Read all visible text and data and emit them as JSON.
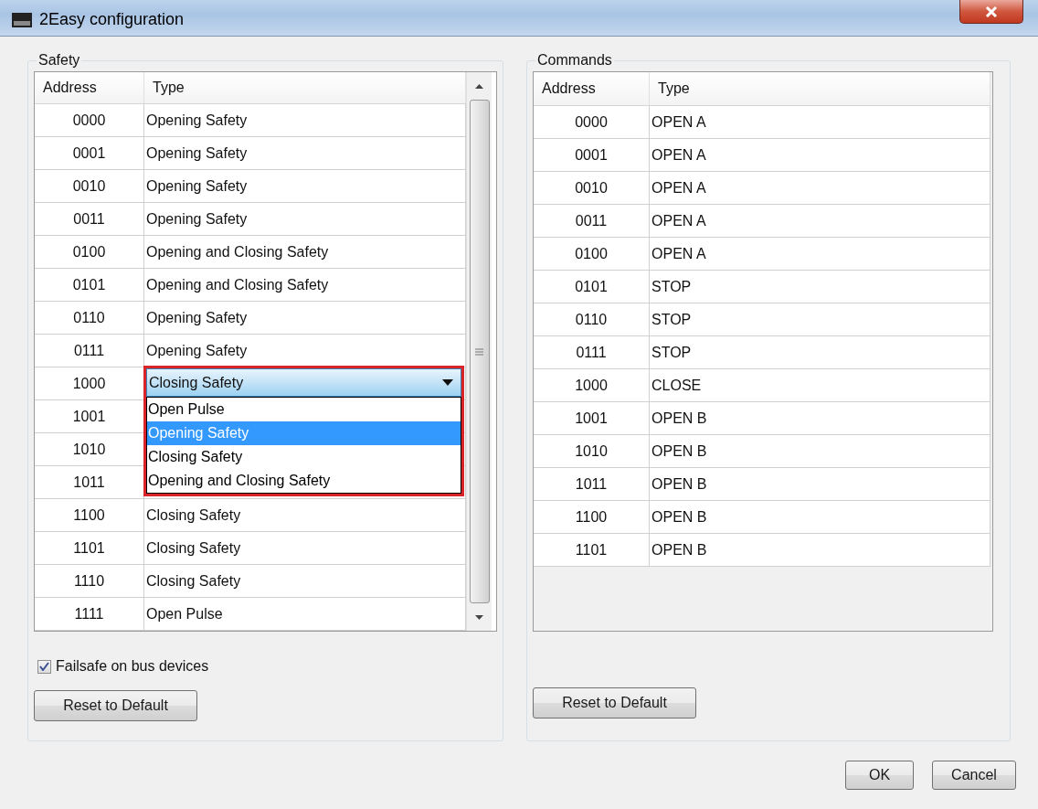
{
  "window": {
    "title": "2Easy configuration"
  },
  "safety": {
    "title": "Safety",
    "columns": [
      "Address",
      "Type"
    ],
    "rows": [
      {
        "address": "0000",
        "type": "Opening Safety",
        "kind": "text"
      },
      {
        "address": "0001",
        "type": "Opening Safety",
        "kind": "text"
      },
      {
        "address": "0010",
        "type": "Opening Safety",
        "kind": "text"
      },
      {
        "address": "0011",
        "type": "Opening Safety",
        "kind": "text"
      },
      {
        "address": "0100",
        "type": "Opening and Closing Safety",
        "kind": "text"
      },
      {
        "address": "0101",
        "type": "Opening and Closing Safety",
        "kind": "text"
      },
      {
        "address": "0110",
        "type": "Opening Safety",
        "kind": "text"
      },
      {
        "address": "0111",
        "type": "Opening Safety",
        "kind": "text"
      },
      {
        "address": "1000",
        "type": "Closing Safety",
        "kind": "combo",
        "options": [
          {
            "label": "Open Pulse",
            "selected": false
          },
          {
            "label": "Opening Safety",
            "selected": true
          },
          {
            "label": "Closing Safety",
            "selected": false
          },
          {
            "label": "Opening and Closing Safety",
            "selected": false
          }
        ]
      },
      {
        "address": "1001",
        "kind": "hidden"
      },
      {
        "address": "1010",
        "kind": "hidden"
      },
      {
        "address": "1011",
        "kind": "hidden"
      },
      {
        "address": "1100",
        "type": "Closing Safety",
        "kind": "text"
      },
      {
        "address": "1101",
        "type": "Closing Safety",
        "kind": "text"
      },
      {
        "address": "1110",
        "type": "Closing Safety",
        "kind": "text"
      },
      {
        "address": "1111",
        "type": "Open Pulse",
        "kind": "text"
      }
    ],
    "checkbox": {
      "label": "Failsafe on bus devices",
      "checked": true
    },
    "reset_button": "Reset to Default"
  },
  "commands": {
    "title": "Commands",
    "columns": [
      "Address",
      "Type"
    ],
    "rows": [
      {
        "address": "0000",
        "type": "OPEN A"
      },
      {
        "address": "0001",
        "type": "OPEN A"
      },
      {
        "address": "0010",
        "type": "OPEN A"
      },
      {
        "address": "0011",
        "type": "OPEN A"
      },
      {
        "address": "0100",
        "type": "OPEN A"
      },
      {
        "address": "0101",
        "type": "STOP"
      },
      {
        "address": "0110",
        "type": "STOP"
      },
      {
        "address": "0111",
        "type": "STOP"
      },
      {
        "address": "1000",
        "type": "CLOSE"
      },
      {
        "address": "1001",
        "type": "OPEN B"
      },
      {
        "address": "1010",
        "type": "OPEN B"
      },
      {
        "address": "1011",
        "type": "OPEN B"
      },
      {
        "address": "1100",
        "type": "OPEN B"
      },
      {
        "address": "1101",
        "type": "OPEN B"
      }
    ],
    "reset_button": "Reset to Default"
  },
  "buttons": [
    "OK",
    "Cancel"
  ]
}
